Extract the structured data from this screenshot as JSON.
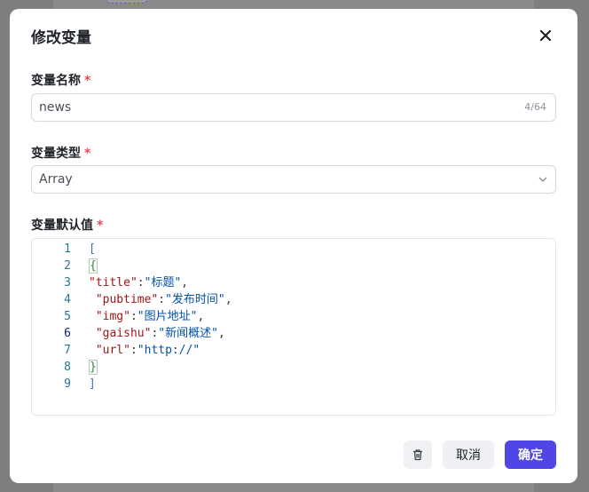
{
  "dialog": {
    "title": "修改变量",
    "close_icon": "close-icon"
  },
  "fields": {
    "name": {
      "label": "变量名称",
      "required_mark": "*",
      "value": "news",
      "counter": "4/64"
    },
    "type": {
      "label": "变量类型",
      "required_mark": "*",
      "selected": "Array"
    },
    "default": {
      "label": "变量默认值",
      "required_mark": "*"
    }
  },
  "editor": {
    "line_numbers": [
      "1",
      "2",
      "3",
      "4",
      "5",
      "6",
      "7",
      "8",
      "9"
    ],
    "active_line": 6,
    "lines": [
      {
        "open": "["
      },
      {
        "open": "{"
      },
      {
        "key": "\"title\"",
        "sep": ":",
        "val": "\"标题\"",
        "end": ","
      },
      {
        "key": " \"pubtime\"",
        "sep": ":",
        "val": "\"发布时间\"",
        "end": ","
      },
      {
        "key": " \"img\"",
        "sep": ":",
        "val": "\"图片地址\"",
        "end": ","
      },
      {
        "key": " \"gaishu\"",
        "sep": ":",
        "val": "\"新闻概述\"",
        "end": ","
      },
      {
        "key": " \"url\"",
        "sep": ":",
        "val": "\"http://\"",
        "end": ""
      },
      {
        "open": "}"
      },
      {
        "open": "]"
      }
    ]
  },
  "footer": {
    "delete_icon": "trash-icon",
    "cancel_label": "取消",
    "confirm_label": "确定"
  },
  "colors": {
    "primary": "#4f46e5",
    "required": "#e34d59",
    "json_key": "#a31515",
    "json_value": "#0451a5"
  }
}
